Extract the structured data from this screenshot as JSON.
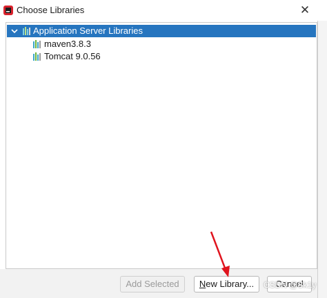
{
  "window": {
    "title": "Choose Libraries",
    "close_glyph": "✕"
  },
  "tree": {
    "root": {
      "label": "Application Server Libraries",
      "expanded": true,
      "selected": true
    },
    "children": [
      {
        "label": "maven3.8.3"
      },
      {
        "label": "Tomcat 9.0.56"
      }
    ]
  },
  "buttons": {
    "add_selected": "Add Selected",
    "new_library_mnemonic": "N",
    "new_library_rest": "ew Library...",
    "cancel": "Cancel"
  },
  "colors": {
    "selection": "#2675bf",
    "annotation_arrow": "#e0141e"
  },
  "watermark": "CSDN @Sk1y"
}
